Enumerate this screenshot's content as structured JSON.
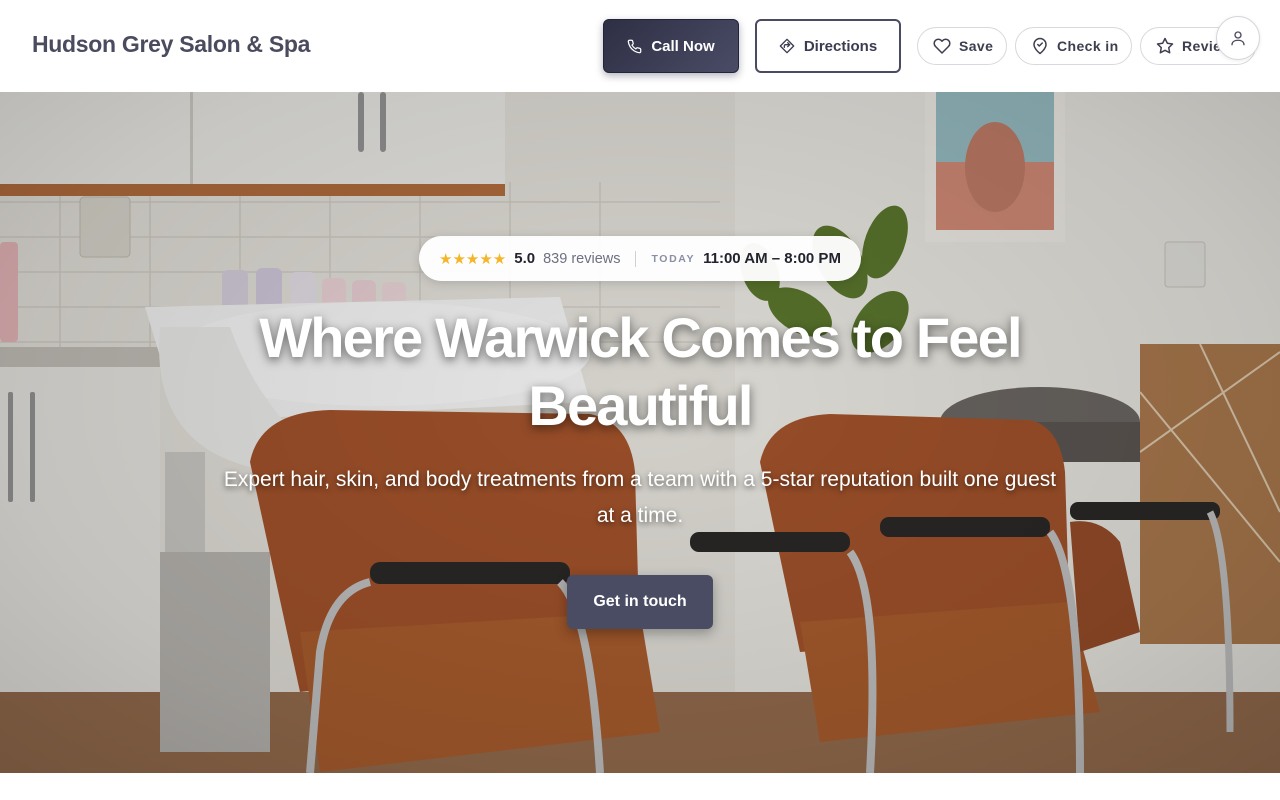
{
  "header": {
    "brand": "Hudson Grey Salon & Spa",
    "call_label": "Call Now",
    "directions_label": "Directions",
    "save_label": "Save",
    "checkin_label": "Check in",
    "reviews_label": "Reviews"
  },
  "hero": {
    "stars": "★★★★★",
    "rating": "5.0",
    "review_count": "839 reviews",
    "today_label": "TODAY",
    "hours": "11:00 AM – 8:00 PM",
    "headline": "Where Warwick Comes to Feel Beautiful",
    "subheadline": "Expert hair, skin, and body treatments from a team with a 5-star reputation built one guest at a time.",
    "cta_label": "Get in touch"
  },
  "icons": {
    "call": "phone-icon",
    "directions": "directions-icon",
    "save": "heart-icon",
    "checkin": "map-pin-icon",
    "reviews": "star-icon",
    "account": "user-icon"
  },
  "colors": {
    "primary": "#3a3b52",
    "star": "#f5b529",
    "cta": "#4a4c63"
  }
}
